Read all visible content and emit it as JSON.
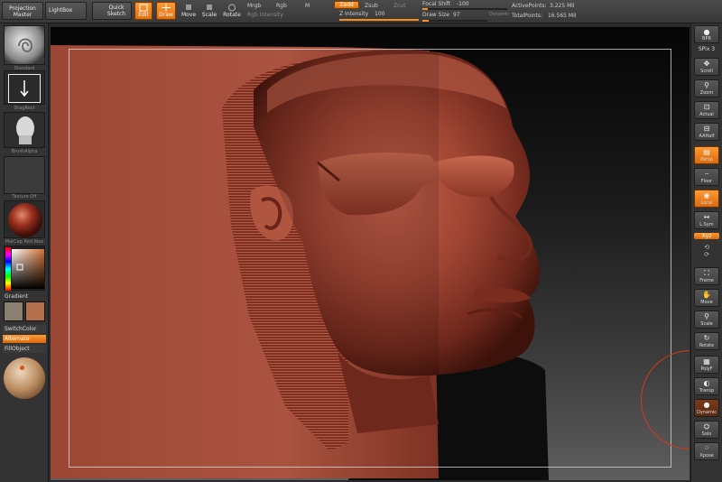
{
  "topbar": {
    "projection_master": "Projection\nMaster",
    "lightbox": "LightBox",
    "quick_sketch": "Quick\nSketch",
    "edit": "Edit",
    "draw": "Draw",
    "move": "Move",
    "scale": "Scale",
    "rotate": "Rotate",
    "mrgb": "Mrgb",
    "rgb": "Rgb",
    "m": "M",
    "rgb_intensity": "Rgb Intensity",
    "zadd": "Zadd",
    "zsub": "Zsub",
    "zcut": "Zcut",
    "z_intensity_label": "Z Intensity",
    "z_intensity_value": "100",
    "z_intensity_level": 1.0,
    "focal_shift_label": "Focal Shift",
    "focal_shift_value": "-100",
    "focal_shift_level": 0.0,
    "draw_size_label": "Draw Size",
    "draw_size_value": "97",
    "draw_size_level": 0.1,
    "dynamic": "Dynamic",
    "active_points_label": "ActivePoints:",
    "active_points_value": "3.225 Mil",
    "total_points_label": "TotalPoints:",
    "total_points_value": "16.565 Mil"
  },
  "left_shelf": {
    "brush_name": "Standard",
    "stroke_name": "DragRect",
    "alpha_name": "BrushAlpha",
    "texture_name": "Texture Off",
    "material_name": "MatCap Red Wax",
    "gradient_label": "Gradient",
    "switch_color_label": "SwitchColor",
    "alternate_label": "Alternate",
    "fill_object_label": "FillObject",
    "main_color": "#b46f4c",
    "secondary_color": "#8a8070"
  },
  "right_shelf": {
    "bpr": "BPR",
    "spix_label": "SPix",
    "spix_value": "3",
    "scroll": "Scroll",
    "zoom": "Zoom",
    "actual": "Actual",
    "aahalf": "AAHalf",
    "persp": "Persp",
    "floor": "Floor",
    "local": "Local",
    "lsym": "L.Sym",
    "xyz": "Xyz",
    "frame": "Frame",
    "move": "Move",
    "scale": "Scale",
    "rotate": "Rotate",
    "polyf": "PolyF",
    "transp": "Transp",
    "ghost": "Dynamic",
    "solo": "Solo",
    "xpose": "Xpose"
  },
  "colors": {
    "accent": "#f08a24",
    "clay": "#8e3a2a",
    "panel": "#333333"
  },
  "icons": [
    "brush-icon",
    "stroke-icon",
    "alpha-icon",
    "texture-icon",
    "material-icon",
    "color-picker-icon",
    "move-icon",
    "scale-icon",
    "rotate-icon",
    "zoom-icon",
    "scroll-icon",
    "frame-icon",
    "floor-icon",
    "local-icon",
    "xpose-icon"
  ]
}
